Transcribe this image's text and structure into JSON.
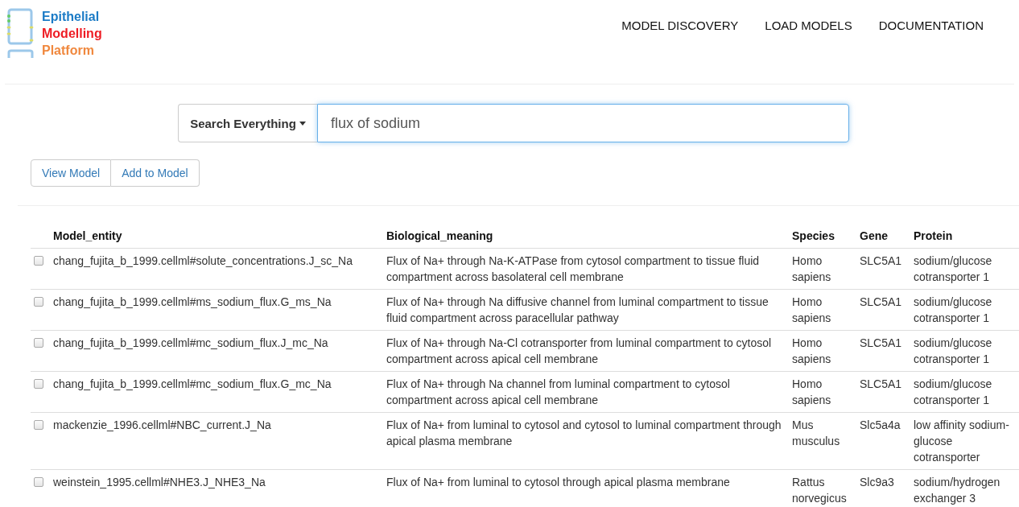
{
  "logo": {
    "lines": [
      "Epithelial",
      "Modelling",
      "Platform"
    ]
  },
  "nav": [
    "MODEL DISCOVERY",
    "LOAD MODELS",
    "DOCUMENTATION"
  ],
  "search": {
    "scope": "Search Everything",
    "value": "flux of sodium"
  },
  "actions": [
    "View Model",
    "Add to Model"
  ],
  "table": {
    "columns": [
      "Model_entity",
      "Biological_meaning",
      "Species",
      "Gene",
      "Protein"
    ],
    "rows": [
      {
        "checked": false,
        "cells": [
          "chang_fujita_b_1999.cellml#solute_concentrations.J_sc_Na",
          "Flux of Na+ through Na-K-ATPase from cytosol compartment to tissue fluid compartment across basolateral cell membrane",
          "Homo sapiens",
          "SLC5A1",
          "sodium/glucose cotransporter 1"
        ]
      },
      {
        "checked": false,
        "cells": [
          "chang_fujita_b_1999.cellml#ms_sodium_flux.G_ms_Na",
          "Flux of Na+ through Na diffusive channel from luminal compartment to tissue fluid compartment across paracellular pathway",
          "Homo sapiens",
          "SLC5A1",
          "sodium/glucose cotransporter 1"
        ]
      },
      {
        "checked": false,
        "cells": [
          "chang_fujita_b_1999.cellml#mc_sodium_flux.J_mc_Na",
          "Flux of Na+ through Na-Cl cotransporter from luminal compartment to cytosol compartment across apical cell membrane",
          "Homo sapiens",
          "SLC5A1",
          "sodium/glucose cotransporter 1"
        ]
      },
      {
        "checked": false,
        "cells": [
          "chang_fujita_b_1999.cellml#mc_sodium_flux.G_mc_Na",
          "Flux of Na+ through Na channel from luminal compartment to cytosol compartment across apical cell membrane",
          "Homo sapiens",
          "SLC5A1",
          "sodium/glucose cotransporter 1"
        ]
      },
      {
        "checked": false,
        "cells": [
          "mackenzie_1996.cellml#NBC_current.J_Na",
          "Flux of Na+ from luminal to cytosol and cytosol to luminal compartment through apical plasma membrane",
          "Mus musculus",
          "Slc5a4a",
          "low affinity sodium-glucose cotransporter"
        ]
      },
      {
        "checked": false,
        "cells": [
          "weinstein_1995.cellml#NHE3.J_NHE3_Na",
          "Flux of Na+ from luminal to cytosol through apical plasma membrane",
          "Rattus norvegicus",
          "Slc9a3",
          "sodium/hydrogen exchanger 3"
        ]
      }
    ]
  }
}
